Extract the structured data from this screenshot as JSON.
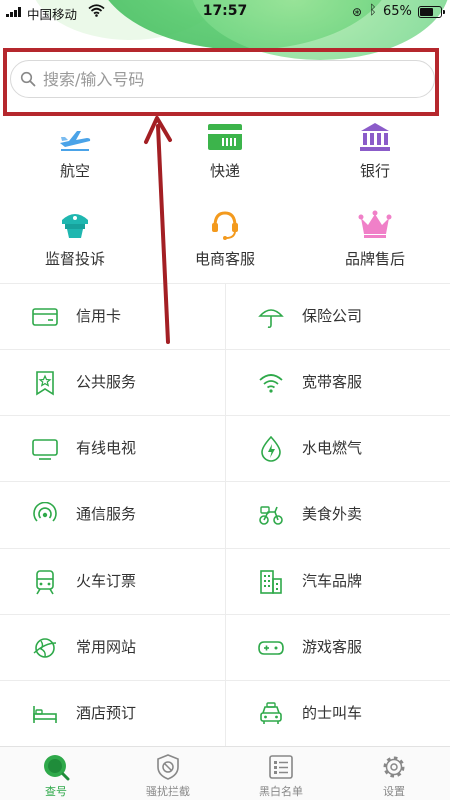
{
  "status_bar": {
    "carrier": "中国移动",
    "time": "17:57",
    "battery": "65%",
    "battery_level": 0.65
  },
  "search": {
    "placeholder": "搜索/输入号码"
  },
  "quick_categories": [
    {
      "label": "航空",
      "icon": "airplane-icon"
    },
    {
      "label": "快递",
      "icon": "truck-icon"
    },
    {
      "label": "银行",
      "icon": "bank-icon"
    },
    {
      "label": "监督投诉",
      "icon": "police-cap-icon"
    },
    {
      "label": "电商客服",
      "icon": "headset-icon"
    },
    {
      "label": "品牌售后",
      "icon": "crown-icon"
    }
  ],
  "categories": [
    {
      "label": "信用卡",
      "icon": "credit-card-icon"
    },
    {
      "label": "保险公司",
      "icon": "umbrella-icon"
    },
    {
      "label": "公共服务",
      "icon": "badge-star-icon"
    },
    {
      "label": "宽带客服",
      "icon": "wifi-icon"
    },
    {
      "label": "有线电视",
      "icon": "tv-icon"
    },
    {
      "label": "水电燃气",
      "icon": "drop-bolt-icon"
    },
    {
      "label": "通信服务",
      "icon": "signal-icon"
    },
    {
      "label": "美食外卖",
      "icon": "scooter-icon"
    },
    {
      "label": "火车订票",
      "icon": "train-icon"
    },
    {
      "label": "汽车品牌",
      "icon": "building-icon"
    },
    {
      "label": "常用网站",
      "icon": "globe-icon"
    },
    {
      "label": "游戏客服",
      "icon": "gamepad-icon"
    },
    {
      "label": "酒店预订",
      "icon": "bed-icon"
    },
    {
      "label": "的士叫车",
      "icon": "taxi-icon"
    }
  ],
  "tab_bar": {
    "active": "查号",
    "tabs": [
      {
        "label": "查号",
        "icon": "search-icon"
      },
      {
        "label": "骚扰拦截",
        "icon": "shield-block-icon"
      },
      {
        "label": "黑白名单",
        "icon": "list-icon"
      },
      {
        "label": "设置",
        "icon": "gear-icon"
      }
    ]
  },
  "colors": {
    "accent_green": "#2fa94a",
    "highlight_red": "#b5272d",
    "arrow_red": "#a31f24"
  }
}
